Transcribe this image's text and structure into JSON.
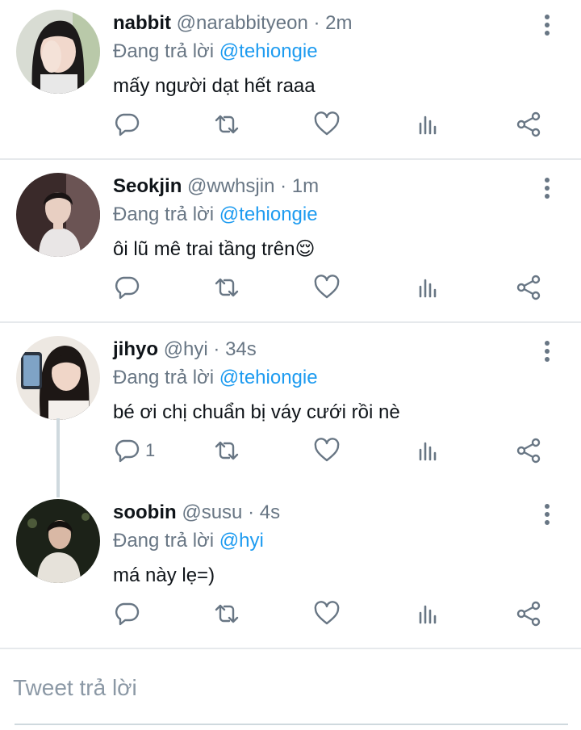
{
  "colors": {
    "accent": "#1d9bf0",
    "muted": "#687684",
    "text": "#0f1419",
    "divider": "#e6e9ec"
  },
  "icons": {
    "reply": "speech-bubble-icon",
    "retweet": "retweet-arrows-icon",
    "like": "heart-icon",
    "stats": "bar-chart-icon",
    "share": "share-nodes-icon",
    "more": "vertical-ellipsis-icon"
  },
  "reply_prefix": "Đang trả lời",
  "tweets": [
    {
      "name": "nabbit",
      "handle": "@narabbityeon",
      "time": "2m",
      "reply_to": "@tehiongie",
      "text": "mấy người dạt hết raaa",
      "reply_count": ""
    },
    {
      "name": "Seokjin",
      "handle": "@wwhsjin",
      "time": "1m",
      "reply_to": "@tehiongie",
      "text": "ôi lũ mê trai tầng trên😌",
      "reply_count": ""
    },
    {
      "name": "jihyo",
      "handle": "@hyi",
      "time": "34s",
      "reply_to": "@tehiongie",
      "text": "bé ơi chị chuẩn bị váy cưới rồi nè",
      "reply_count": "1"
    },
    {
      "name": "soobin",
      "handle": "@susu",
      "time": "4s",
      "reply_to": "@hyi",
      "text": "má này lẹ=)",
      "reply_count": ""
    }
  ],
  "composer": {
    "placeholder": "Tweet trả lời"
  }
}
